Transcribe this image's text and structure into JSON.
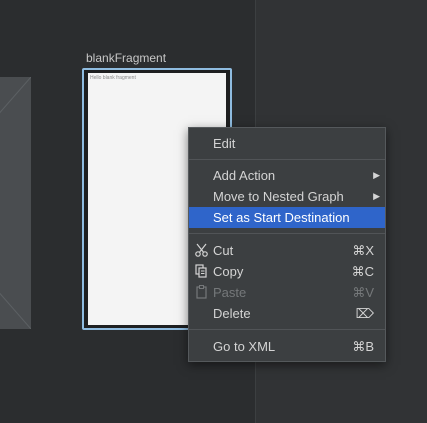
{
  "fragment": {
    "label": "blankFragment",
    "screen_text": "Hello blank fragment"
  },
  "context_menu": {
    "edit": "Edit",
    "add_action": "Add Action",
    "move_to_nested_graph": "Move to Nested Graph",
    "set_as_start_destination": "Set as Start Destination",
    "cut": "Cut",
    "cut_shortcut": "⌘X",
    "copy": "Copy",
    "copy_shortcut": "⌘C",
    "paste": "Paste",
    "paste_shortcut": "⌘V",
    "delete": "Delete",
    "delete_shortcut": "⌦",
    "go_to_xml": "Go to XML",
    "go_to_xml_shortcut": "⌘B",
    "submenu_arrow": "▶"
  },
  "colors": {
    "selection": "#2f65ca",
    "fragment_border": "#8fbce0",
    "menu_background": "#3c3f41",
    "canvas_background": "#2b2d2f"
  }
}
